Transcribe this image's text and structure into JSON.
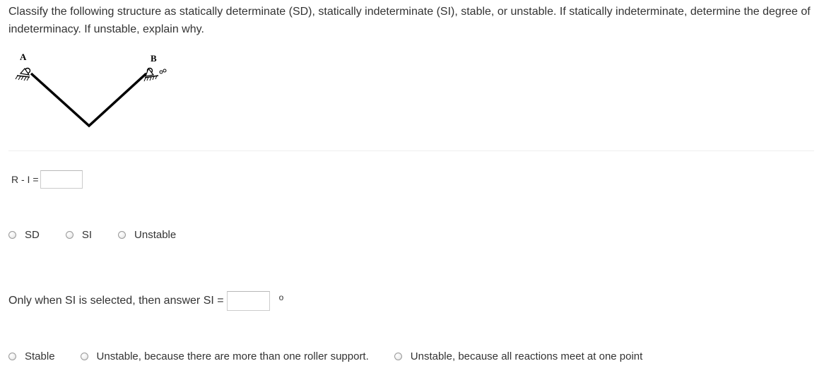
{
  "question": {
    "text": "Classify the following structure as statically determinate (SD), statically indeterminate (SI), stable, or unstable. If statically indeterminate, determine the degree of indeterminacy.  If unstable, explain why."
  },
  "figure": {
    "label_a": "A",
    "label_b": "B"
  },
  "ri": {
    "label": "R - I =",
    "value": ""
  },
  "classification": {
    "options": [
      "SD",
      "SI",
      "Unstable"
    ]
  },
  "si_answer": {
    "prompt": "Only when SI is selected, then answer SI =",
    "value": "",
    "unit": "o"
  },
  "stability": {
    "options": [
      "Stable",
      "Unstable, because there are more than one roller support.",
      "Unstable, because all reactions meet at one point"
    ]
  },
  "colors": {
    "text": "#333333",
    "radio_border": "#9a9a9a",
    "input_border": "#cccccc",
    "divider": "#eeeeee"
  }
}
